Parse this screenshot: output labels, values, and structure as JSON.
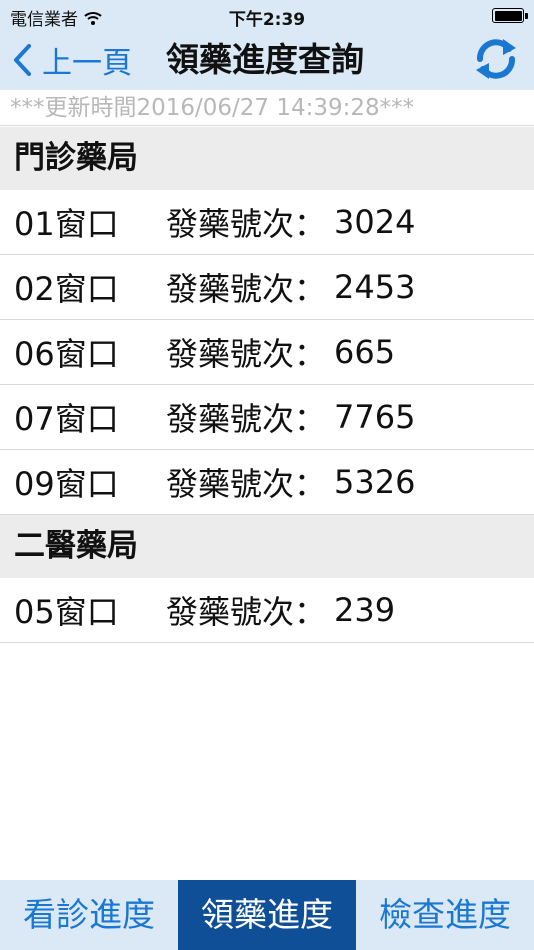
{
  "status_bar": {
    "carrier": "電信業者",
    "time": "下午2:39",
    "wifi_icon": "wifi-icon",
    "battery_icon": "battery-icon"
  },
  "nav": {
    "back_label": "上一頁",
    "title": "領藥進度查詢",
    "refresh_icon": "refresh-icon",
    "accent_color": "#1a77d2"
  },
  "update_time": "***更新時間2016/06/27 14:39:28***",
  "sections": [
    {
      "title": "門診藥局",
      "rows": [
        {
          "window": "01窗口",
          "label": "發藥號次：",
          "number": "3024"
        },
        {
          "window": "02窗口",
          "label": "發藥號次：",
          "number": "2453"
        },
        {
          "window": "06窗口",
          "label": "發藥號次：",
          "number": "665"
        },
        {
          "window": "07窗口",
          "label": "發藥號次：",
          "number": "7765"
        },
        {
          "window": "09窗口",
          "label": "發藥號次：",
          "number": "5326"
        }
      ]
    },
    {
      "title": "二醫藥局",
      "rows": [
        {
          "window": "05窗口",
          "label": "發藥號次：",
          "number": "239"
        }
      ]
    }
  ],
  "tabs": [
    {
      "label": "看診進度",
      "active": false
    },
    {
      "label": "領藥進度",
      "active": true
    },
    {
      "label": "檢查進度",
      "active": false
    }
  ],
  "colors": {
    "bar_background": "#dbe8f5",
    "tab_active": "#0f4f97",
    "section_background": "#ececec",
    "update_text": "#b8b8b8"
  }
}
